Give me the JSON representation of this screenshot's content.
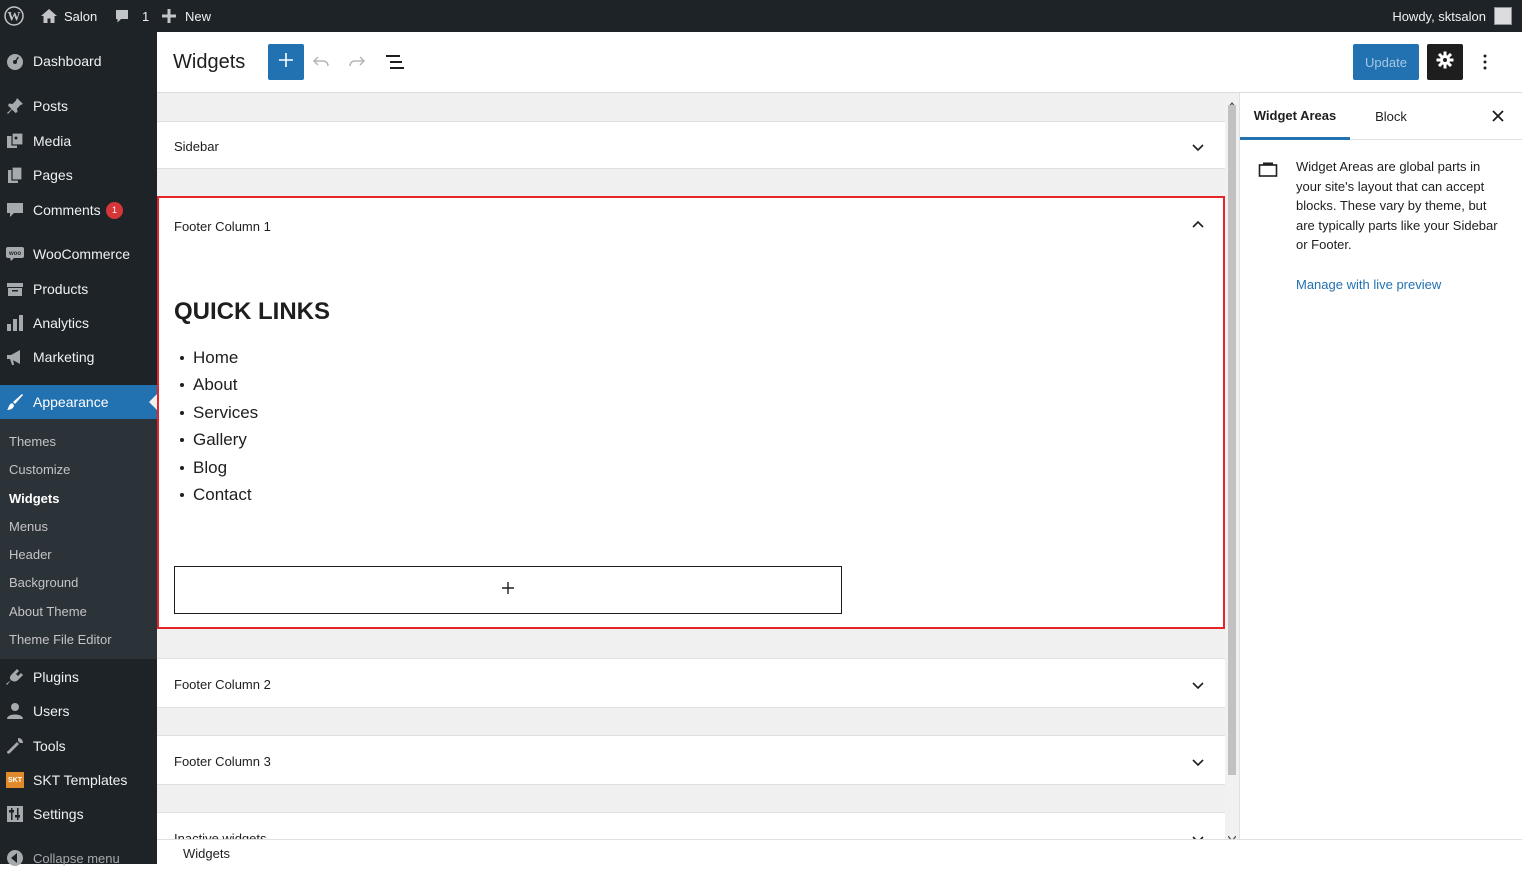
{
  "adminbar": {
    "site_name": "Salon",
    "comments_count": "1",
    "new_label": "New",
    "howdy": "Howdy, sktsalon"
  },
  "menu": {
    "dashboard": "Dashboard",
    "posts": "Posts",
    "media": "Media",
    "pages": "Pages",
    "comments": "Comments",
    "comments_badge": "1",
    "woocommerce": "WooCommerce",
    "products": "Products",
    "analytics": "Analytics",
    "marketing": "Marketing",
    "appearance": "Appearance",
    "submenu": {
      "themes": "Themes",
      "customize": "Customize",
      "widgets": "Widgets",
      "menus": "Menus",
      "header": "Header",
      "background": "Background",
      "about_theme": "About Theme",
      "theme_file_editor": "Theme File Editor"
    },
    "plugins": "Plugins",
    "users": "Users",
    "tools": "Tools",
    "skt_templates": "SKT Templates",
    "skt_icon_text": "SKT",
    "settings": "Settings",
    "collapse": "Collapse menu"
  },
  "header": {
    "title": "Widgets",
    "update": "Update"
  },
  "areas": {
    "sidebar": "Sidebar",
    "footer1": "Footer Column 1",
    "footer2": "Footer Column 2",
    "footer3": "Footer Column 3",
    "inactive": "Inactive widgets"
  },
  "quick_links": {
    "heading": "QUICK LINKS",
    "items": [
      "Home",
      "About",
      "Services",
      "Gallery",
      "Blog",
      "Contact"
    ]
  },
  "sidebar_panel": {
    "tab_areas": "Widget Areas",
    "tab_block": "Block",
    "description": "Widget Areas are global parts in your site's layout that can accept blocks. These vary by theme, but are typically parts like your Sidebar or Footer.",
    "manage_link": "Manage with live preview"
  },
  "footer": {
    "breadcrumb": "Widgets"
  },
  "colors": {
    "accent": "#2271b1",
    "highlight_border": "#e52629",
    "admin_bg": "#1d2327",
    "badge": "#d63638"
  }
}
